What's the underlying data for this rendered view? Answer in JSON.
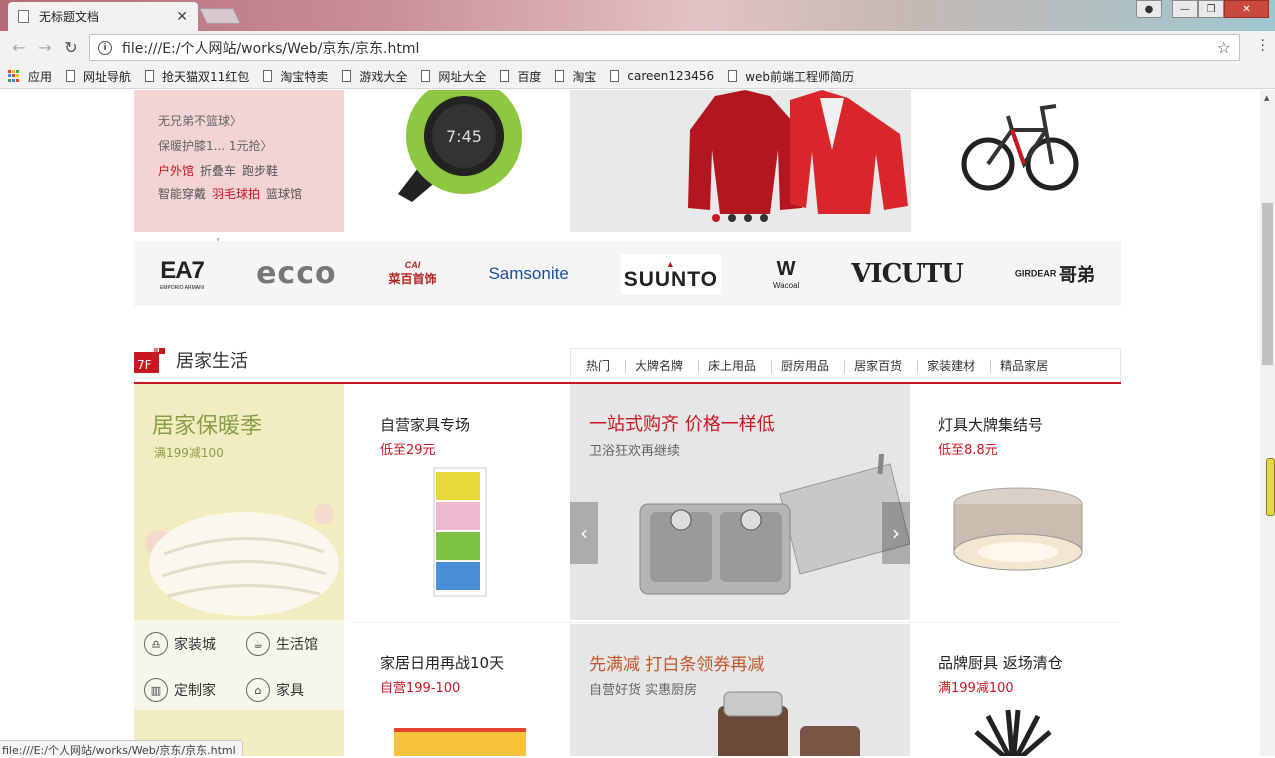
{
  "browser": {
    "tab_title": "无标题文档",
    "url": "file:///E:/个人网站/works/Web/京东/京东.html",
    "status_url": "file:///E:/个人网站/works/Web/京东/京东.html"
  },
  "bookmarks": {
    "apps": "应用",
    "items": [
      "网址导航",
      "抢天猫双11红包",
      "淘宝特卖",
      "游戏大全",
      "网址大全",
      "百度",
      "淘宝",
      "careen123456",
      "web前端工程师简历"
    ]
  },
  "top_promo": {
    "line1": "无兄弟不篮球",
    "line2": "保暖护膝1... 1元抢",
    "tags_row1": [
      "户外馆",
      "折叠车",
      "跑步鞋"
    ],
    "tags_row2": [
      "智能穿戴",
      "羽毛球拍",
      "篮球馆"
    ]
  },
  "brands": {
    "ea7": "EA7",
    "ea7_sub": "EMPORIO ARMANI",
    "ecco": "ecco",
    "cai_logo": "CAI",
    "cai": "菜百首饰",
    "samsonite": "Samsonite",
    "suunto": "SUUNTO",
    "wacoal": "Wacoal",
    "vicutu": "VICUTU",
    "girdear": "GIRDEAR",
    "girdear_cn": "哥弟"
  },
  "floor": {
    "badge": "7F",
    "title": "居家生活",
    "tabs": [
      "热门",
      "大牌名牌",
      "床上用品",
      "厨房用品",
      "居家百货",
      "家装建材",
      "精品家居"
    ]
  },
  "left_banner": {
    "title": "居家保暖季",
    "subtitle": "满199减100",
    "links": [
      "家装城",
      "生活馆",
      "定制家",
      "家具"
    ]
  },
  "products": {
    "p1_title": "自营家具专场",
    "p1_price": "低至29元",
    "p2_title": "灯具大牌集结号",
    "p2_price": "低至8.8元",
    "p3_title": "家居日用再战10天",
    "p3_price": "自营199-100",
    "p4_title": "品牌厨具 返场清仓",
    "p4_price": "满199减100"
  },
  "center_slide": {
    "title": "一站式购齐 价格一样低",
    "subtitle": "卫浴狂欢再继续"
  },
  "center_slide2": {
    "title": "先满减  打白条领券再减",
    "subtitle": "自营好货 实惠厨房"
  },
  "colors": {
    "jd_red": "#c81623",
    "banner_green": "#8a9e4a"
  }
}
